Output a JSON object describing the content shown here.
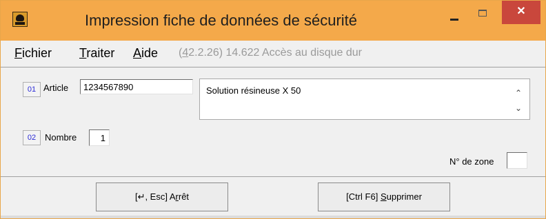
{
  "window": {
    "title": "Impression fiche de données de sécurité",
    "close_glyph": "✕"
  },
  "menu": {
    "items": [
      {
        "mnemonic": "F",
        "rest": "ichier"
      },
      {
        "mnemonic": "T",
        "rest": "raiter"
      },
      {
        "mnemonic": "A",
        "rest": "ide"
      }
    ],
    "status_prefix": "(",
    "status_mnemonic": "4",
    "status_rest": "2.2.26) 14.622 Accès au disque dur"
  },
  "fields": {
    "article": {
      "number": "01",
      "label": "Article",
      "value": "1234567890",
      "description": "Solution résineuse X 50"
    },
    "nombre": {
      "number": "02",
      "label": "Nombre",
      "value": "1"
    },
    "zone": {
      "label": "N° de zone",
      "value": ""
    }
  },
  "scroll": {
    "up_glyph": "⌃",
    "down_glyph": "⌄"
  },
  "buttons": {
    "stop": {
      "prefix": "[↵, Esc] A",
      "mnemonic": "r",
      "suffix": "rêt"
    },
    "delete": {
      "prefix": "[Ctrl F6] ",
      "mnemonic": "S",
      "suffix": "upprimer"
    }
  },
  "colors": {
    "titlebar": "#f4a94a",
    "close_button": "#c9473c",
    "field_number_text": "#2a2ad6"
  },
  "icons": {
    "app": "skull-crossbones-icon",
    "minimize": "minimize-icon",
    "maximize": "maximize-icon",
    "close": "close-icon"
  }
}
